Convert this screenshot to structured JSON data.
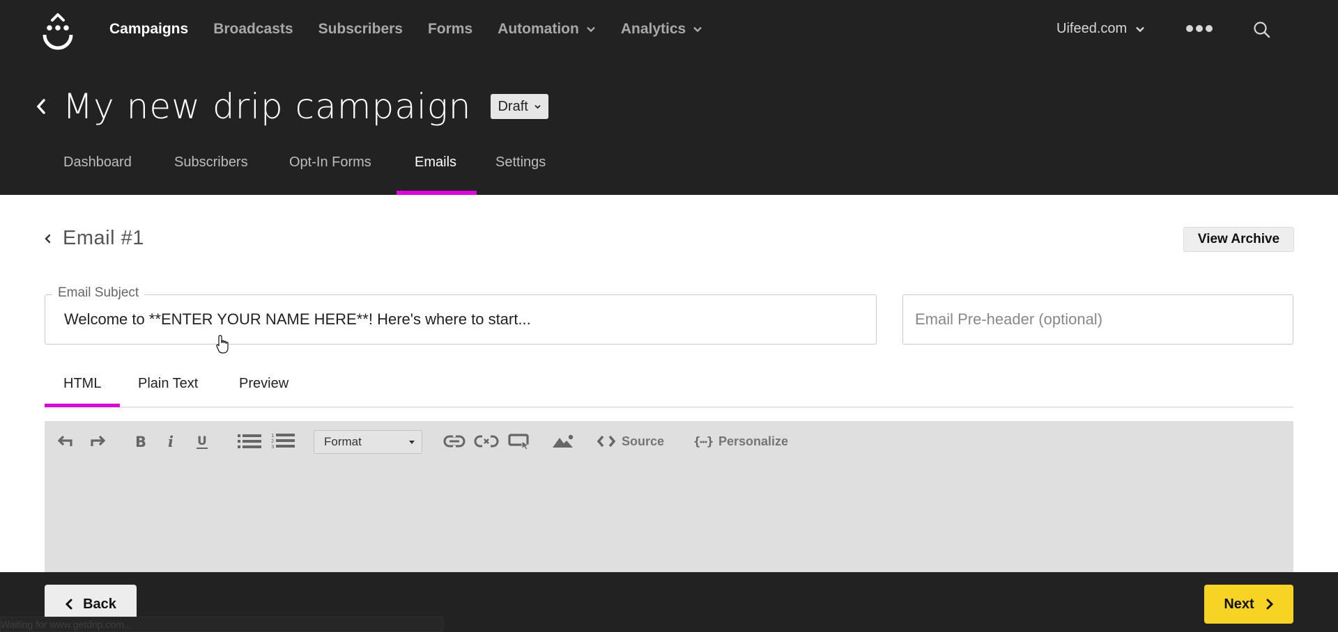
{
  "app": {
    "brand_logo": "smiley-drop-logo",
    "main_nav": [
      {
        "label": "Campaigns",
        "active": true,
        "dropdown": false
      },
      {
        "label": "Broadcasts",
        "active": false,
        "dropdown": false
      },
      {
        "label": "Subscribers",
        "active": false,
        "dropdown": false
      },
      {
        "label": "Forms",
        "active": false,
        "dropdown": false
      },
      {
        "label": "Automation",
        "active": false,
        "dropdown": true
      },
      {
        "label": "Analytics",
        "active": false,
        "dropdown": true
      }
    ],
    "account_label": "Uifeed.com",
    "more_icon": "ellipsis-icon",
    "search_icon": "search-icon"
  },
  "campaign": {
    "title": "My new drip campaign",
    "status": "Draft",
    "tabs": [
      {
        "label": "Dashboard",
        "active": false
      },
      {
        "label": "Subscribers",
        "active": false
      },
      {
        "label": "Opt-In Forms",
        "active": false
      },
      {
        "label": "Emails",
        "active": true
      },
      {
        "label": "Settings",
        "active": false
      }
    ]
  },
  "email": {
    "heading": "Email #1",
    "view_archive_label": "View Archive",
    "subject_label": "Email Subject",
    "subject_value": "Welcome to **ENTER YOUR NAME HERE**! Here's where to start...",
    "preheader_placeholder": "Email Pre-header (optional)",
    "preheader_value": "",
    "editor_tabs": [
      {
        "label": "HTML",
        "active": true
      },
      {
        "label": "Plain Text",
        "active": false
      },
      {
        "label": "Preview",
        "active": false
      }
    ],
    "toolbar": {
      "format_label": "Format",
      "source_label": "Source",
      "personalize_label": "Personalize"
    }
  },
  "footer": {
    "back_label": "Back",
    "next_label": "Next",
    "browser_status": "Waiting for www.getdrip.com..."
  },
  "colors": {
    "header_bg": "#222222",
    "accent_magenta": "#e000e0",
    "next_yellow": "#f7d323",
    "editor_bg": "#dfdfdf"
  }
}
